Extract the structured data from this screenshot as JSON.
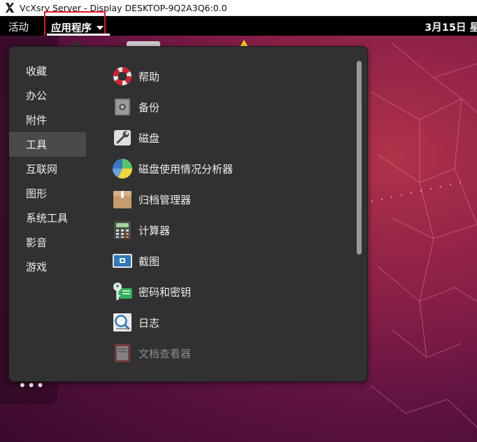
{
  "window": {
    "title": "VcXsrv Server - Display DESKTOP-9Q2A3Q6:0.0",
    "icon": "vcxsrv-x-icon"
  },
  "topbar": {
    "activities": "活动",
    "applications": "应用程序",
    "clock": "3月15日 星"
  },
  "dock": {
    "show_apps": "•••"
  },
  "menu": {
    "categories": [
      {
        "label": "收藏",
        "selected": false
      },
      {
        "label": "办公",
        "selected": false
      },
      {
        "label": "附件",
        "selected": false
      },
      {
        "label": "工具",
        "selected": true
      },
      {
        "label": "互联网",
        "selected": false
      },
      {
        "label": "图形",
        "selected": false
      },
      {
        "label": "系统工具",
        "selected": false
      },
      {
        "label": "影音",
        "selected": false
      },
      {
        "label": "游戏",
        "selected": false
      }
    ],
    "apps": [
      {
        "label": "帮助",
        "icon": "lifebuoy-icon"
      },
      {
        "label": "备份",
        "icon": "safe-icon"
      },
      {
        "label": "磁盘",
        "icon": "disk-wrench-icon"
      },
      {
        "label": "磁盘使用情况分析器",
        "icon": "pie-chart-icon"
      },
      {
        "label": "归档管理器",
        "icon": "archive-box-icon"
      },
      {
        "label": "计算器",
        "icon": "calculator-icon"
      },
      {
        "label": "截图",
        "icon": "screenshot-icon"
      },
      {
        "label": "密码和密钥",
        "icon": "key-icon"
      },
      {
        "label": "日志",
        "icon": "log-magnifier-icon"
      },
      {
        "label": "文档查看器",
        "icon": "document-viewer-icon",
        "dimmed": true
      }
    ]
  }
}
